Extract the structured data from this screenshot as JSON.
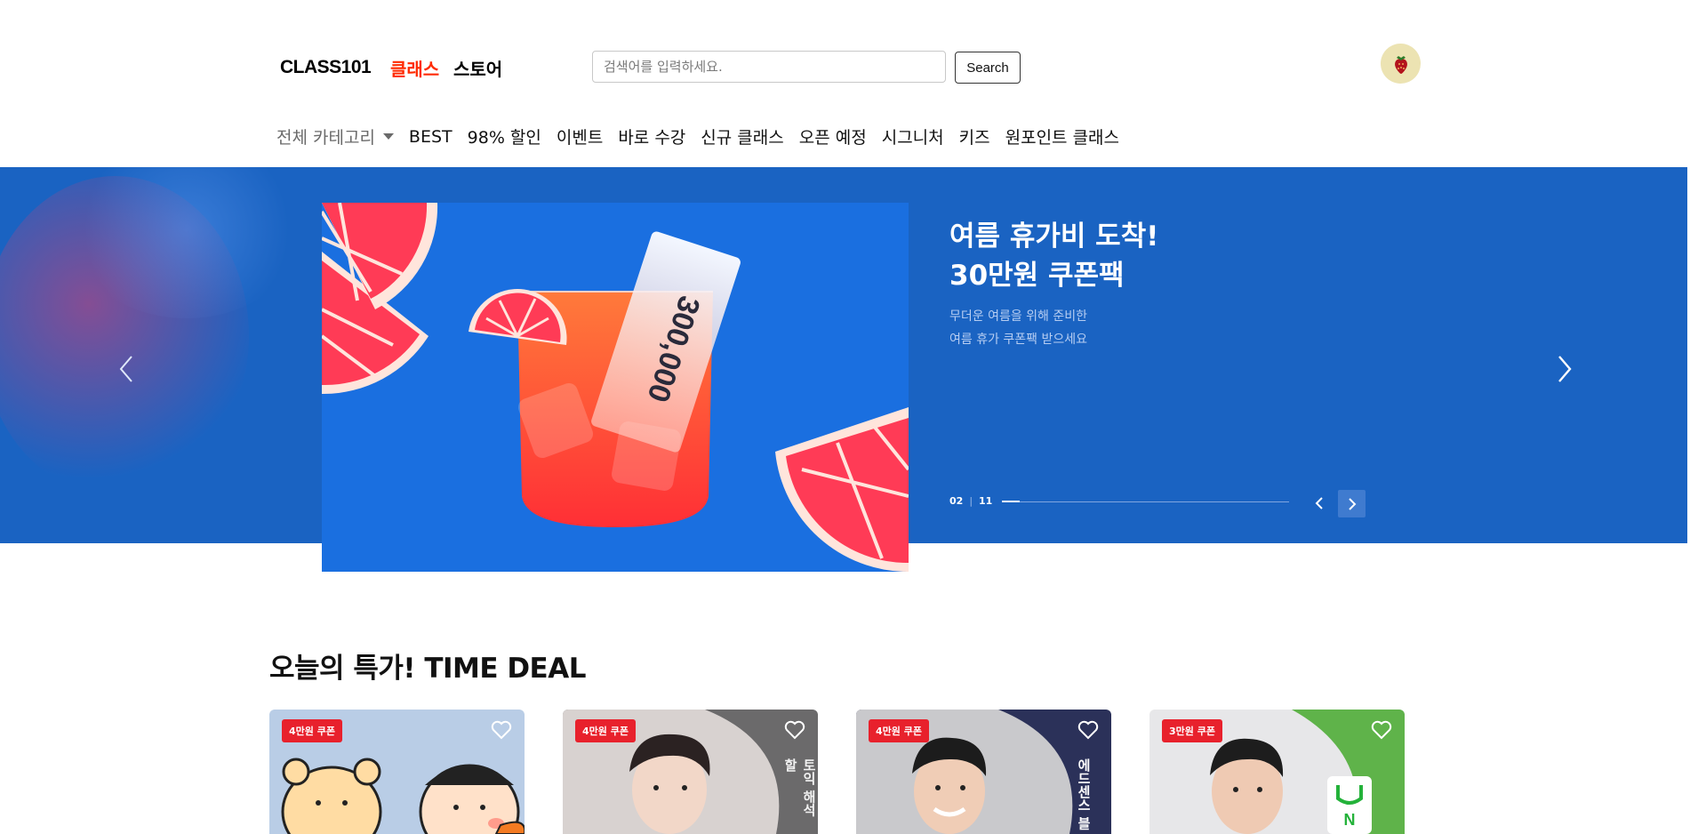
{
  "header": {
    "logo": "CLASS101",
    "nav_class": "클래스",
    "nav_store": "스토어",
    "search_placeholder": "검색어를 입력하세요.",
    "search_button": "Search"
  },
  "category_nav": {
    "all_label": "전체 카테고리",
    "items": [
      "BEST",
      "98% 할인",
      "이벤트",
      "바로 수강",
      "신규 클래스",
      "오픈 예정",
      "시그니처",
      "키즈",
      "원포인트 클래스"
    ]
  },
  "banner": {
    "title": "여름 휴가비 도착!\n30만원 쿠폰팩",
    "subtitle": "무더운 여름을 위해 준비한\n여름 휴가 쿠폰팩 받으세요",
    "ticket_text": "300,000",
    "current": "02",
    "total": "11",
    "progress": 0.0626,
    "background_color": "#1a63c2",
    "prev_icon": "chevron-left-icon",
    "next_icon": "chevron-right-icon"
  },
  "time_deal": {
    "title": "오늘의 특가! TIME DEAL",
    "cards": [
      {
        "badge": "4만원 쿠폰",
        "bg": "#b9cde6"
      },
      {
        "badge": "4만원 쿠폰",
        "bg": "#6b6a6b",
        "side_text": "토익 해석 할"
      },
      {
        "badge": "4만원 쿠폰",
        "bg": "#2b3159",
        "side_text": "에드센스 블"
      },
      {
        "badge": "3만원 쿠폰",
        "bg": "#e7e7e9"
      }
    ]
  },
  "colors": {
    "brand_red": "#ff2a00",
    "badge_red": "#e8212c",
    "banner_blue": "#1a63c2"
  }
}
